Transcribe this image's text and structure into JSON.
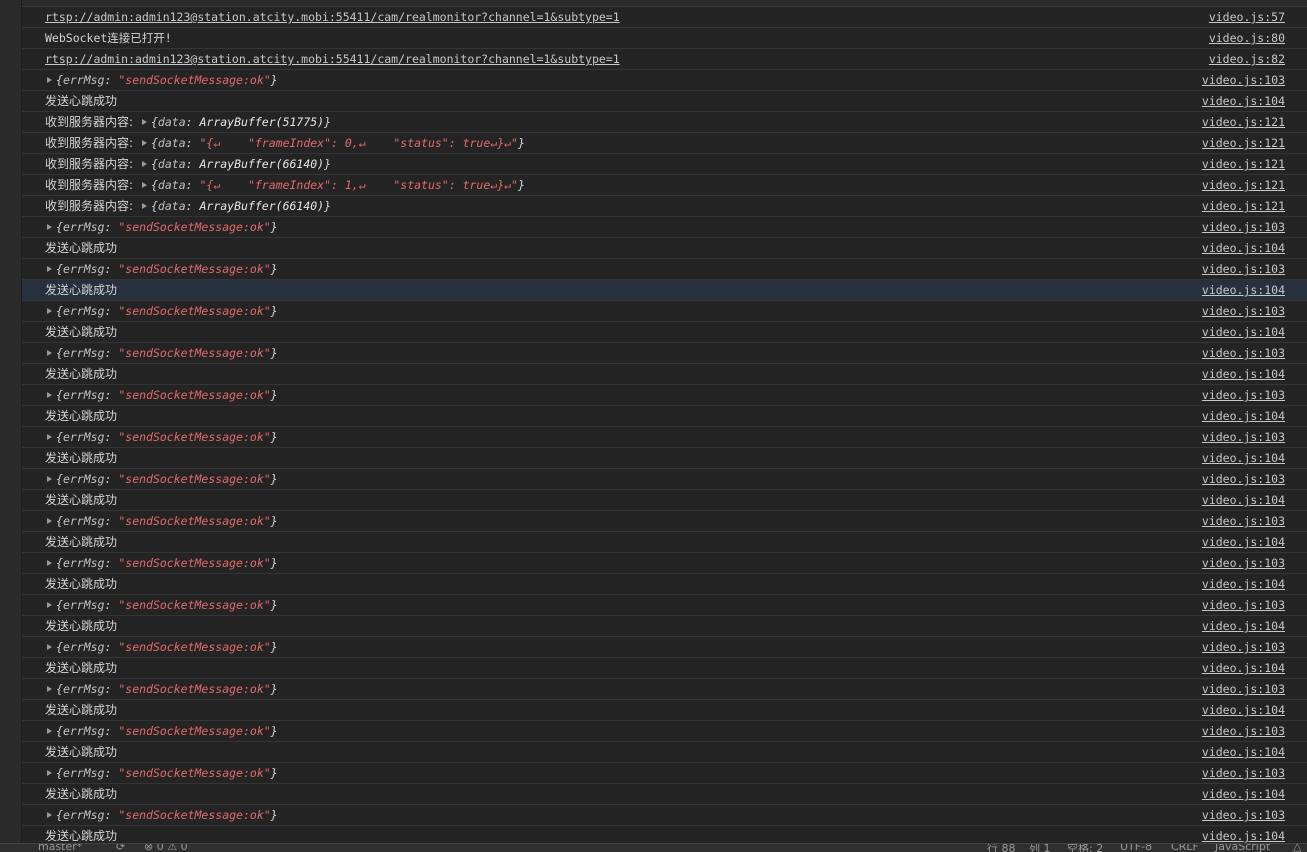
{
  "console": {
    "rows": [
      {
        "type": "link",
        "text": "rtsp://admin:admin123@station.atcity.mobi:55411/cam/realmonitor?channel=1&subtype=1",
        "src": "video.js:57"
      },
      {
        "type": "text",
        "text": "WebSocket连接已打开!",
        "src": "video.js:80"
      },
      {
        "type": "link",
        "text": "rtsp://admin:admin123@station.atcity.mobi:55411/cam/realmonitor?channel=1&subtype=1",
        "src": "video.js:82"
      },
      {
        "type": "obj",
        "key": "errMsg",
        "val": "\"sendSocketMessage:ok\"",
        "src": "video.js:103"
      },
      {
        "type": "cjk",
        "text": "发送心跳成功",
        "src": "video.js:104"
      },
      {
        "type": "recv",
        "prefix": "收到服务器内容:",
        "key": "data",
        "plain": "ArrayBuffer(51775)",
        "src": "video.js:121"
      },
      {
        "type": "recv",
        "prefix": "收到服务器内容:",
        "key": "data",
        "val": "\"{↵    \"frameIndex\": 0,↵    \"status\": true↵}↵\"",
        "src": "video.js:121"
      },
      {
        "type": "recv",
        "prefix": "收到服务器内容:",
        "key": "data",
        "plain": "ArrayBuffer(66140)",
        "src": "video.js:121"
      },
      {
        "type": "recv",
        "prefix": "收到服务器内容:",
        "key": "data",
        "val": "\"{↵    \"frameIndex\": 1,↵    \"status\": true↵}↵\"",
        "src": "video.js:121"
      },
      {
        "type": "recv",
        "prefix": "收到服务器内容:",
        "key": "data",
        "plain": "ArrayBuffer(66140)",
        "src": "video.js:121"
      },
      {
        "type": "obj",
        "key": "errMsg",
        "val": "\"sendSocketMessage:ok\"",
        "src": "video.js:103"
      },
      {
        "type": "cjk",
        "text": "发送心跳成功",
        "src": "video.js:104"
      },
      {
        "type": "obj",
        "key": "errMsg",
        "val": "\"sendSocketMessage:ok\"",
        "src": "video.js:103"
      },
      {
        "type": "cjk",
        "text": "发送心跳成功",
        "src": "video.js:104",
        "selected": true
      },
      {
        "type": "obj",
        "key": "errMsg",
        "val": "\"sendSocketMessage:ok\"",
        "src": "video.js:103"
      },
      {
        "type": "cjk",
        "text": "发送心跳成功",
        "src": "video.js:104"
      },
      {
        "type": "obj",
        "key": "errMsg",
        "val": "\"sendSocketMessage:ok\"",
        "src": "video.js:103"
      },
      {
        "type": "cjk",
        "text": "发送心跳成功",
        "src": "video.js:104"
      },
      {
        "type": "obj",
        "key": "errMsg",
        "val": "\"sendSocketMessage:ok\"",
        "src": "video.js:103"
      },
      {
        "type": "cjk",
        "text": "发送心跳成功",
        "src": "video.js:104"
      },
      {
        "type": "obj",
        "key": "errMsg",
        "val": "\"sendSocketMessage:ok\"",
        "src": "video.js:103"
      },
      {
        "type": "cjk",
        "text": "发送心跳成功",
        "src": "video.js:104"
      },
      {
        "type": "obj",
        "key": "errMsg",
        "val": "\"sendSocketMessage:ok\"",
        "src": "video.js:103"
      },
      {
        "type": "cjk",
        "text": "发送心跳成功",
        "src": "video.js:104"
      },
      {
        "type": "obj",
        "key": "errMsg",
        "val": "\"sendSocketMessage:ok\"",
        "src": "video.js:103"
      },
      {
        "type": "cjk",
        "text": "发送心跳成功",
        "src": "video.js:104"
      },
      {
        "type": "obj",
        "key": "errMsg",
        "val": "\"sendSocketMessage:ok\"",
        "src": "video.js:103"
      },
      {
        "type": "cjk",
        "text": "发送心跳成功",
        "src": "video.js:104"
      },
      {
        "type": "obj",
        "key": "errMsg",
        "val": "\"sendSocketMessage:ok\"",
        "src": "video.js:103"
      },
      {
        "type": "cjk",
        "text": "发送心跳成功",
        "src": "video.js:104"
      },
      {
        "type": "obj",
        "key": "errMsg",
        "val": "\"sendSocketMessage:ok\"",
        "src": "video.js:103"
      },
      {
        "type": "cjk",
        "text": "发送心跳成功",
        "src": "video.js:104"
      },
      {
        "type": "obj",
        "key": "errMsg",
        "val": "\"sendSocketMessage:ok\"",
        "src": "video.js:103"
      },
      {
        "type": "cjk",
        "text": "发送心跳成功",
        "src": "video.js:104"
      },
      {
        "type": "obj",
        "key": "errMsg",
        "val": "\"sendSocketMessage:ok\"",
        "src": "video.js:103"
      },
      {
        "type": "cjk",
        "text": "发送心跳成功",
        "src": "video.js:104"
      },
      {
        "type": "obj",
        "key": "errMsg",
        "val": "\"sendSocketMessage:ok\"",
        "src": "video.js:103"
      },
      {
        "type": "cjk",
        "text": "发送心跳成功",
        "src": "video.js:104"
      },
      {
        "type": "obj",
        "key": "errMsg",
        "val": "\"sendSocketMessage:ok\"",
        "src": "video.js:103"
      },
      {
        "type": "cjk",
        "text": "发送心跳成功",
        "src": "video.js:104"
      }
    ]
  },
  "statusbar": {
    "branch": "master*",
    "problems": "⊗ 0 ⚠ 0",
    "line": "行 88",
    "col": "列 1",
    "spaces": "空格: 2",
    "encoding": "UTF-8",
    "eol": "CRLF",
    "language": "JavaScript"
  }
}
